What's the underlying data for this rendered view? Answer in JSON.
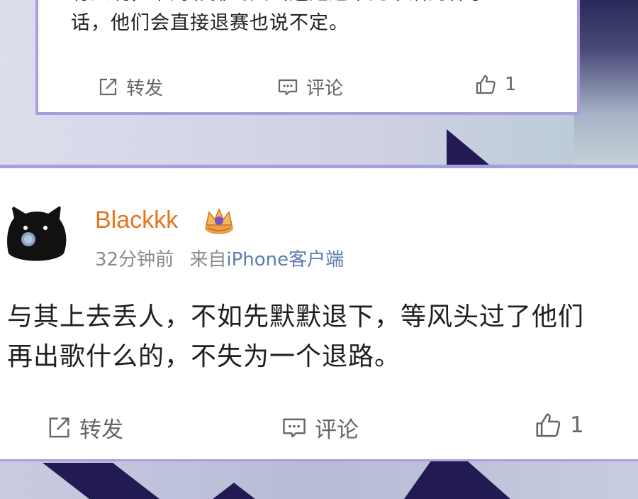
{
  "top_post": {
    "text_line1": "有人说，下周彩排到大山还是这半死不活的样子",
    "text_line2": "话，他们会直接退赛也说不定。",
    "actions": {
      "repost_label": "转发",
      "comment_label": "评论",
      "like_count": "1"
    }
  },
  "main_post": {
    "username": "Blackkk",
    "time": "32分钟前",
    "source_prefix": "来自",
    "source": "iPhone客户端",
    "content_line1": "与其上去丢人，不如先默默退下，等风头过了他们",
    "content_line2": "再出歌什么的，不失为一个退路。",
    "actions": {
      "repost_label": "转发",
      "comment_label": "评论",
      "like_count": "1"
    }
  },
  "icons": {
    "repost": "repost-icon",
    "comment": "comment-icon",
    "like": "thumbs-up-icon",
    "badge": "vip-crown-badge-icon",
    "avatar": "black-cat-avatar"
  },
  "colors": {
    "username": "#e8741e",
    "source_link": "#5b7db3",
    "card_border": "#a79de0"
  }
}
